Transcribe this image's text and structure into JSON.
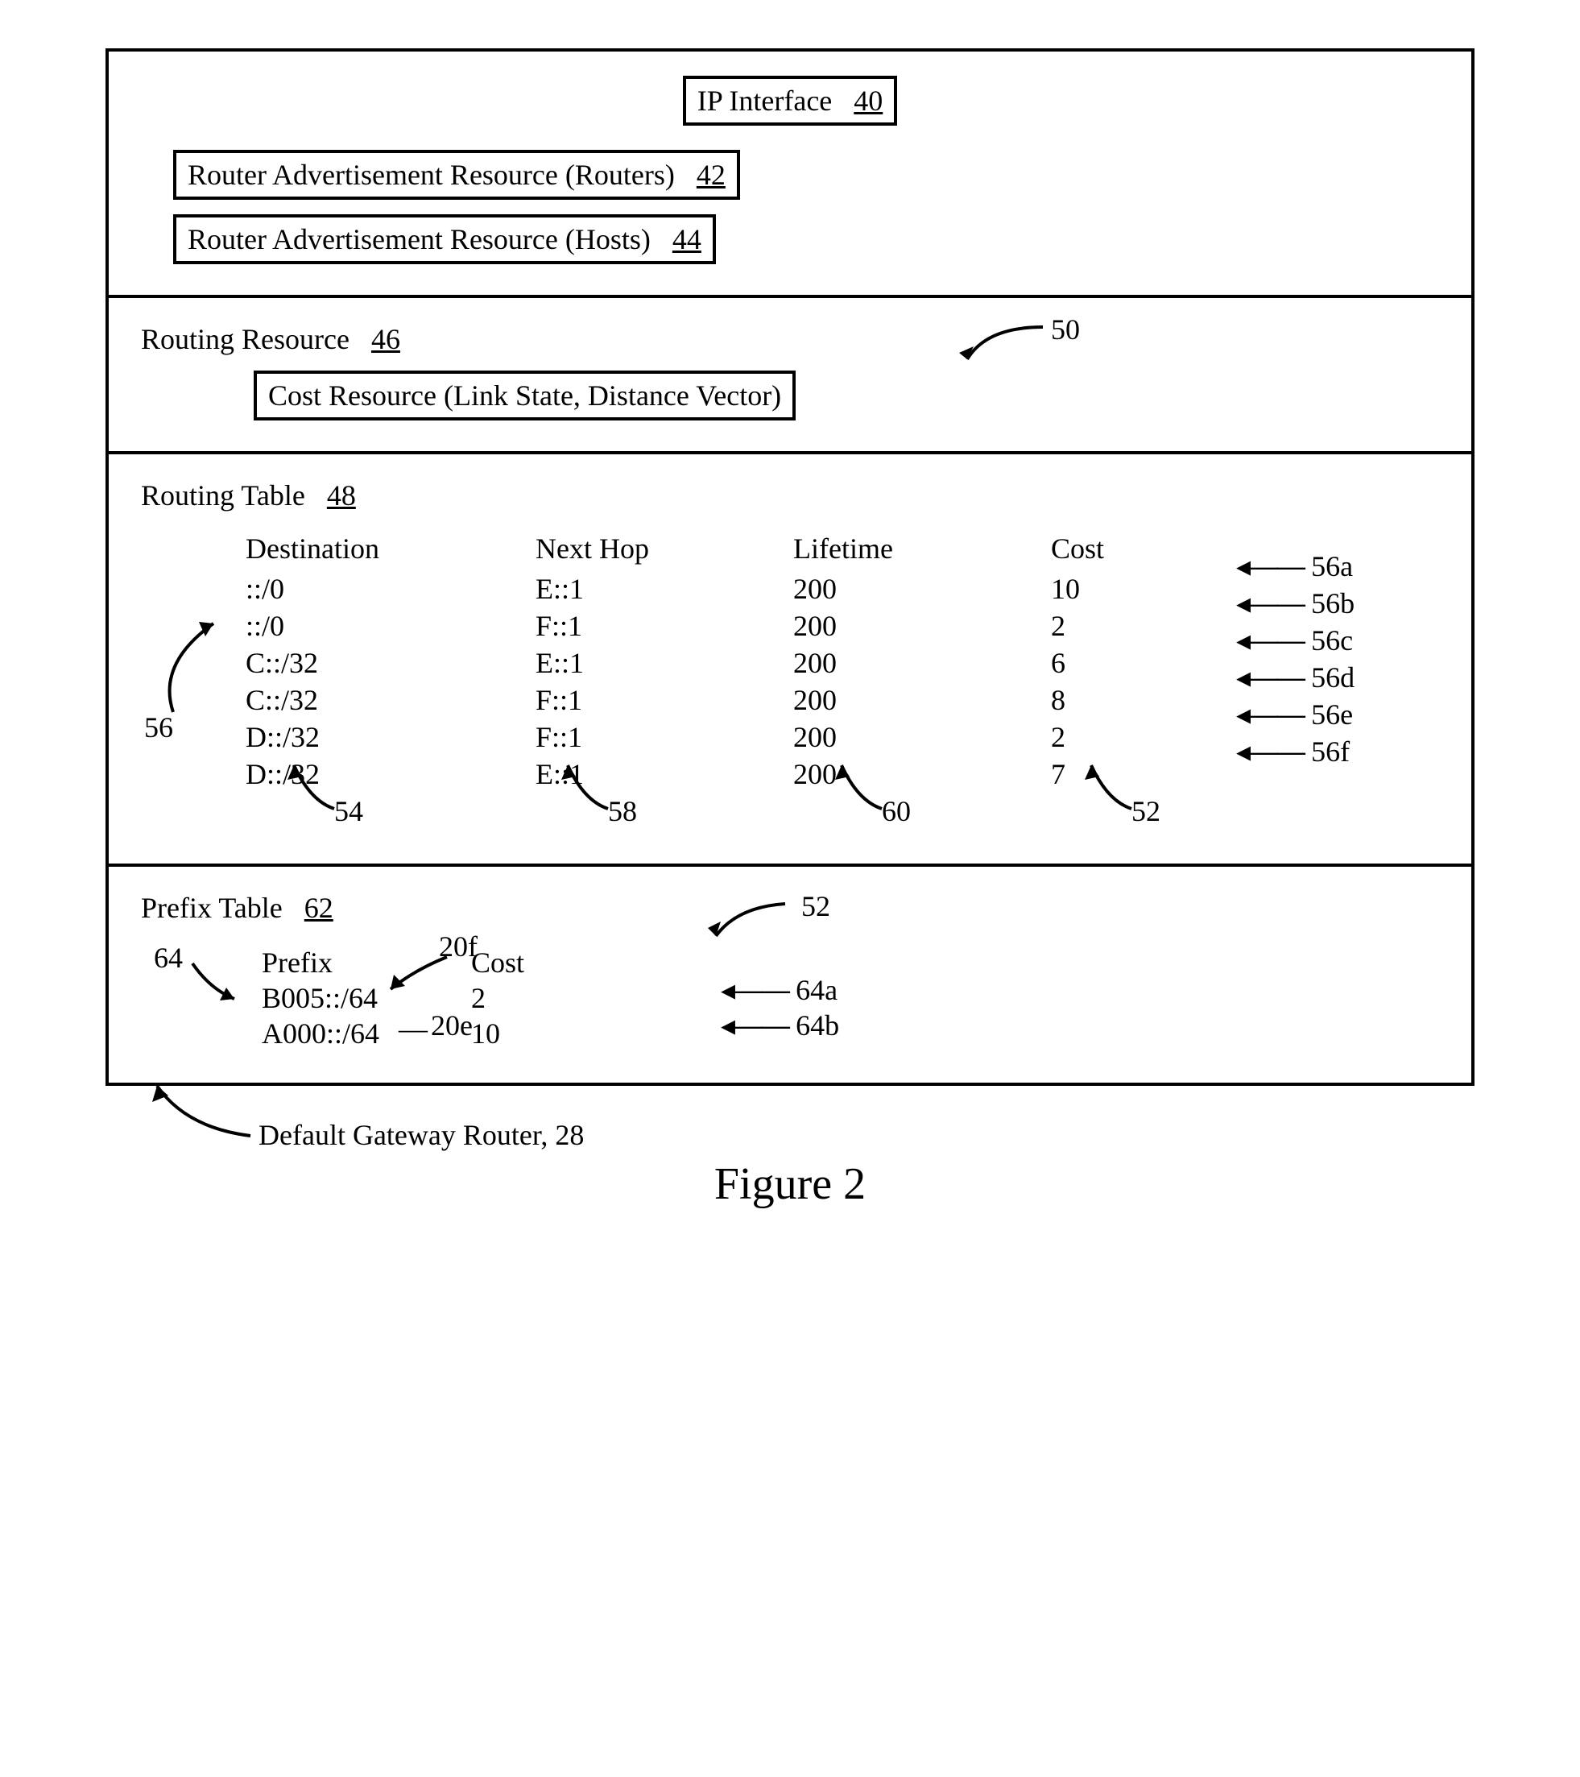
{
  "top_section": {
    "ip_interface": {
      "label": "IP Interface",
      "ref": "40"
    },
    "rar_routers": {
      "label": "Router Advertisement Resource (Routers)",
      "ref": "42"
    },
    "rar_hosts": {
      "label": "Router Advertisement Resource (Hosts)",
      "ref": "44"
    }
  },
  "routing_resource": {
    "title": "Routing Resource",
    "ref": "46",
    "cost_resource": {
      "label": "Cost Resource (Link State, Distance Vector)",
      "ref": "50"
    }
  },
  "routing_table": {
    "title": "Routing Table",
    "ref": "48",
    "headers": {
      "dest": "Destination",
      "next": "Next Hop",
      "life": "Lifetime",
      "cost": "Cost"
    },
    "rows": [
      {
        "dest": "::/0",
        "next": "E::1",
        "life": "200",
        "cost": "10",
        "anno": "56a"
      },
      {
        "dest": "::/0",
        "next": "F::1",
        "life": "200",
        "cost": "2",
        "anno": "56b"
      },
      {
        "dest": "C::/32",
        "next": "E::1",
        "life": "200",
        "cost": "6",
        "anno": "56c"
      },
      {
        "dest": "C::/32",
        "next": "F::1",
        "life": "200",
        "cost": "8",
        "anno": "56d"
      },
      {
        "dest": "D::/32",
        "next": "F::1",
        "life": "200",
        "cost": "2",
        "anno": "56e"
      },
      {
        "dest": "D::/32",
        "next": "E::1",
        "life": "200",
        "cost": "7",
        "anno": "56f"
      }
    ],
    "col_anno": {
      "dest_col": "54",
      "next_col": "58",
      "life_col": "60",
      "cost_col": "52",
      "rows_anno": "56"
    }
  },
  "prefix_table": {
    "title": "Prefix Table",
    "ref": "62",
    "headers": {
      "prefix": "Prefix",
      "cost": "Cost"
    },
    "col_anno": {
      "prefix_col": "64",
      "cost_col": "52"
    },
    "rows": [
      {
        "prefix": "B005::/64",
        "cost": "2",
        "prefix_anno": "20f",
        "cost_anno": "64a"
      },
      {
        "prefix": "A000::/64",
        "cost": "10",
        "prefix_anno": "20e",
        "cost_anno": "64b"
      }
    ]
  },
  "footer": {
    "label": "Default Gateway Router, 28"
  },
  "figure_caption": "Figure 2",
  "glyph": {
    "larrow": "◂——"
  }
}
